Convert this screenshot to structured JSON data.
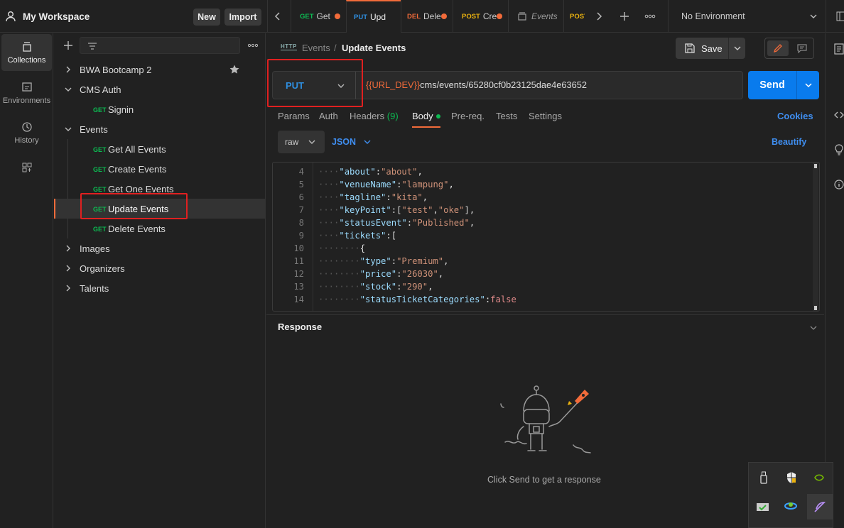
{
  "workspace": {
    "name": "My Workspace",
    "new_label": "New",
    "import_label": "Import"
  },
  "tabs": [
    {
      "method": "GET",
      "name": "Get",
      "color": "#0cbb52",
      "dot": true
    },
    {
      "method": "PUT",
      "name": "Upd",
      "color": "#2f8fe0",
      "dot": false,
      "active": true
    },
    {
      "method": "DEL",
      "name": "Dele",
      "color": "#f26b3a",
      "dot": true
    },
    {
      "method": "POST",
      "name": "Cre",
      "color": "#eab20f",
      "dot": true
    },
    {
      "method": "",
      "name": "Events",
      "italic": true
    },
    {
      "method": "POST",
      "name": "",
      "color": "#eab20f"
    }
  ],
  "environment": {
    "selected": "No Environment"
  },
  "rail": [
    {
      "label": "Collections",
      "icon": "collections-icon",
      "active": true
    },
    {
      "label": "Environments",
      "icon": "environments-icon"
    },
    {
      "label": "History",
      "icon": "history-icon"
    },
    {
      "label": "",
      "icon": "apis-icon"
    }
  ],
  "sidebar": {
    "collections": [
      {
        "name": "BWA Bootcamp 2",
        "expanded": false,
        "starred": true
      },
      {
        "name": "CMS Auth",
        "expanded": true,
        "requests": [
          {
            "method": "GET",
            "name": "Signin"
          }
        ]
      },
      {
        "name": "Events",
        "expanded": true,
        "requests": [
          {
            "method": "GET",
            "name": "Get All Events"
          },
          {
            "method": "GET",
            "name": "Create Events"
          },
          {
            "method": "GET",
            "name": "Get One Events"
          },
          {
            "method": "GET",
            "name": "Update Events",
            "selected": true
          },
          {
            "method": "GET",
            "name": "Delete Events"
          }
        ]
      },
      {
        "name": "Images",
        "expanded": false
      },
      {
        "name": "Organizers",
        "expanded": false
      },
      {
        "name": "Talents",
        "expanded": false
      }
    ]
  },
  "request": {
    "protocol_badge": "HTTP",
    "breadcrumb_parent": "Events",
    "breadcrumb_sep": "/",
    "title": "Update Events",
    "save_label": "Save",
    "method": "PUT",
    "url_var": "{{URL_DEV}}",
    "url_path": "cms/events/65280cf0b23125dae4e63652",
    "send_label": "Send"
  },
  "subtabs": {
    "params": "Params",
    "auth": "Auth",
    "headers": "Headers",
    "headers_count": "(9)",
    "body": "Body",
    "prereq": "Pre-req.",
    "tests": "Tests",
    "settings": "Settings",
    "cookies": "Cookies"
  },
  "body_options": {
    "mode": "raw",
    "format": "JSON",
    "beautify": "Beautify"
  },
  "code_lines": [
    {
      "n": "4",
      "indent": 1,
      "key": "about",
      "val": "\"about\"",
      "tail": ","
    },
    {
      "n": "5",
      "indent": 1,
      "key": "venueName",
      "val": "\"lampung\"",
      "tail": ","
    },
    {
      "n": "6",
      "indent": 1,
      "key": "tagline",
      "val": "\"kita\"",
      "tail": ","
    },
    {
      "n": "7",
      "indent": 1,
      "key": "keyPoint",
      "raw": ":[\"test\",\"oke\"],"
    },
    {
      "n": "8",
      "indent": 1,
      "key": "statusEvent",
      "val": "\"Published\"",
      "tail": ","
    },
    {
      "n": "9",
      "indent": 1,
      "key": "tickets",
      "raw": ":["
    },
    {
      "n": "10",
      "indent": 2,
      "plain": "{"
    },
    {
      "n": "11",
      "indent": 2,
      "key": "type",
      "val": "\"Premium\"",
      "tail": ","
    },
    {
      "n": "12",
      "indent": 2,
      "key": "price",
      "val": "\"26030\"",
      "tail": ","
    },
    {
      "n": "13",
      "indent": 2,
      "key": "stock",
      "val": "\"290\"",
      "tail": ","
    },
    {
      "n": "14",
      "indent": 2,
      "key": "statusTicketCategories",
      "val": "false",
      "tail": "",
      "bool": true
    }
  ],
  "response": {
    "title": "Response",
    "empty_text": "Click Send to get a response"
  },
  "colors": {
    "accent": "#f26b3a",
    "send": "#097bed",
    "get": "#0cbb52",
    "put": "#2f8fe0",
    "post": "#eab20f",
    "highlight_box": "#e02020"
  }
}
